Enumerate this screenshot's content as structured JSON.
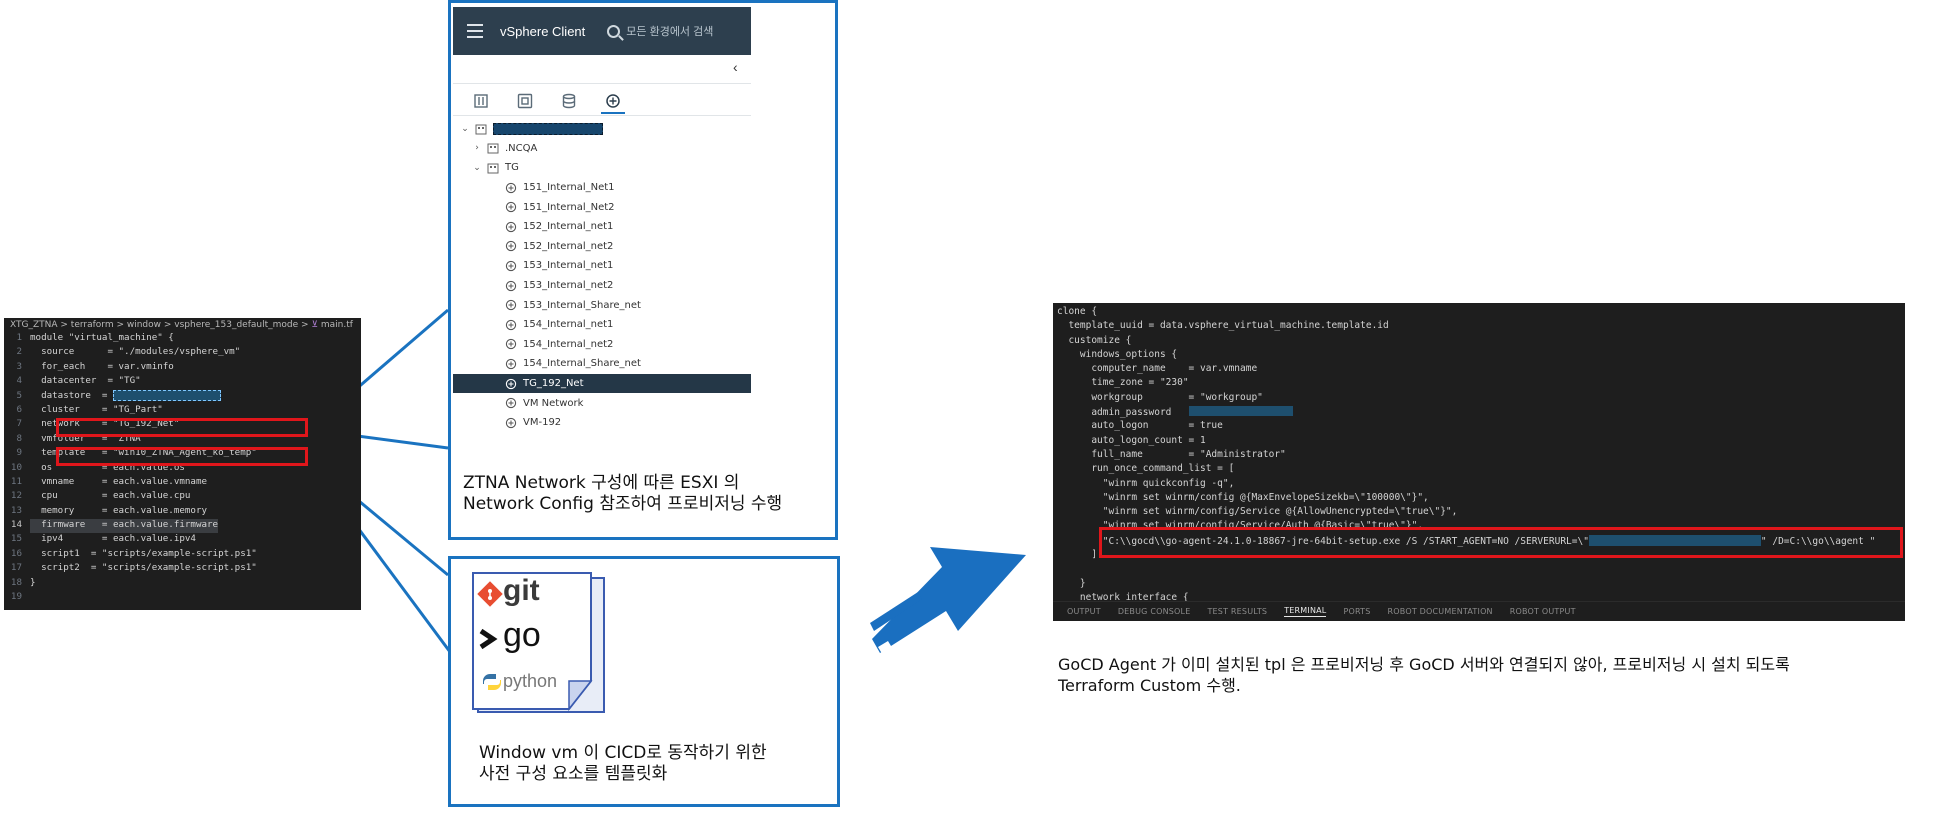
{
  "editor": {
    "breadcrumb": "XTG_ZTNA > terraform > window > vsphere_153_default_mode > ",
    "file_name": "main.tf",
    "lines": [
      {
        "n": "1",
        "text": "module \"virtual_machine\" {"
      },
      {
        "n": "2",
        "text": "  source      = \"./modules/vsphere_vm\""
      },
      {
        "n": "3",
        "text": "  for_each    = var.vminfo"
      },
      {
        "n": "4",
        "text": "  datacenter  = \"TG\""
      },
      {
        "n": "5",
        "text": "  datastore  = "
      },
      {
        "n": "6",
        "text": "  cluster    = \"TG_Part\""
      },
      {
        "n": "7",
        "text": "  network    = \"TG_192_Net\""
      },
      {
        "n": "8",
        "text": "  vmfolder   = \"ZTNA\""
      },
      {
        "n": "9",
        "text": "  template   = \"win10_ZTNA_Agent_ko_temp\""
      },
      {
        "n": "10",
        "text": "  os         = each.value.os"
      },
      {
        "n": "11",
        "text": "  vmname     = each.value.vmname"
      },
      {
        "n": "12",
        "text": "  cpu        = each.value.cpu"
      },
      {
        "n": "13",
        "text": "  memory     = each.value.memory"
      },
      {
        "n": "14",
        "text": "  firmware   = each.value.firmware"
      },
      {
        "n": "15",
        "text": "  ipv4       = each.value.ipv4"
      },
      {
        "n": "16",
        "text": "  script1  = \"scripts/example-script.ps1\""
      },
      {
        "n": "17",
        "text": "  script2  = \"scripts/example-script.ps1\""
      },
      {
        "n": "18",
        "text": "}"
      },
      {
        "n": "19",
        "text": ""
      }
    ]
  },
  "vsphere": {
    "title": "vSphere Client",
    "search_placeholder": "모든 환경에서 검색",
    "collapse_glyph": "‹",
    "tree": [
      {
        "label": ".NCQA",
        "chev": "›",
        "icon": "folder-icon",
        "depth": 1
      },
      {
        "label": "TG",
        "chev": "⌄",
        "icon": "folder-icon",
        "depth": 1
      },
      {
        "label": "151_Internal_Net1",
        "icon": "network-icon",
        "depth": 2
      },
      {
        "label": "151_Internal_Net2",
        "icon": "network-icon",
        "depth": 2
      },
      {
        "label": "152_Internal_net1",
        "icon": "network-icon",
        "depth": 2
      },
      {
        "label": "152_Internal_net2",
        "icon": "network-icon",
        "depth": 2
      },
      {
        "label": "153_Internal_net1",
        "icon": "network-icon",
        "depth": 2
      },
      {
        "label": "153_Internal_net2",
        "icon": "network-icon",
        "depth": 2
      },
      {
        "label": "153_Internal_Share_net",
        "icon": "network-icon",
        "depth": 2
      },
      {
        "label": "154_Internal_net1",
        "icon": "network-icon",
        "depth": 2
      },
      {
        "label": "154_Internal_net2",
        "icon": "network-icon",
        "depth": 2
      },
      {
        "label": "154_Internal_Share_net",
        "icon": "network-icon",
        "depth": 2
      },
      {
        "label": "TG_192_Net",
        "icon": "network-icon",
        "depth": 2,
        "selected": true
      },
      {
        "label": "VM Network",
        "icon": "network-icon",
        "depth": 2
      },
      {
        "label": "VM-192",
        "icon": "network-icon",
        "depth": 2
      }
    ],
    "caption_line1": "ZTNA Network 구성에 따른 ESXI 의",
    "caption_line2": "Network Config 참조하여 프로비저닝 수행"
  },
  "templates": {
    "git_label": "git",
    "go_label": "go",
    "python_label": "python",
    "caption_line1": "Window vm 이 CICD로 동작하기 위한",
    "caption_line2": "사전 구성 요소를 템플릿화"
  },
  "terraform": {
    "lines": [
      "clone {",
      "  template_uuid = data.vsphere_virtual_machine.template.id",
      "  customize {",
      "    windows_options {",
      "      computer_name    = var.vmname",
      "      time_zone = \"230\"",
      "      workgroup        = \"workgroup\"",
      "      admin_password   ",
      "      auto_logon       = true",
      "      auto_logon_count = 1",
      "      full_name        = \"Administrator\"",
      "      run_once_command_list = [",
      "        \"winrm quickconfig -q\",",
      "        \"winrm set winrm/config @{MaxEnvelopeSizekb=\\\"100000\\\"}\",",
      "        \"winrm set winrm/config/Service @{AllowUnencrypted=\\\"true\\\"}\",",
      "        \"winrm set winrm/config/Service/Auth @{Basic=\\\"true\\\"}\",",
      "        \"C:\\\\gocd\\\\go-agent-24.1.0-18867-jre-64bit-setup.exe /S /START_AGENT=NO /SERVERURL=\\\"",
      "      ]",
      "",
      "    }",
      "    network_interface {"
    ],
    "gocd_line_suffix": "\" /D=C:\\\\go\\\\agent \"",
    "panel_tabs": [
      "OUTPUT",
      "DEBUG CONSOLE",
      "TEST RESULTS",
      "TERMINAL",
      "PORTS",
      "ROBOT DOCUMENTATION",
      "ROBOT OUTPUT"
    ],
    "active_panel_tab": "TERMINAL",
    "caption_line1": "GoCD Agent 가 이미 설치된 tpl 은 프로비저닝 후 GoCD 서버와 연결되지 않아, 프로비저닝 시 설치 되도록",
    "caption_line2": "Terraform Custom 수행."
  }
}
